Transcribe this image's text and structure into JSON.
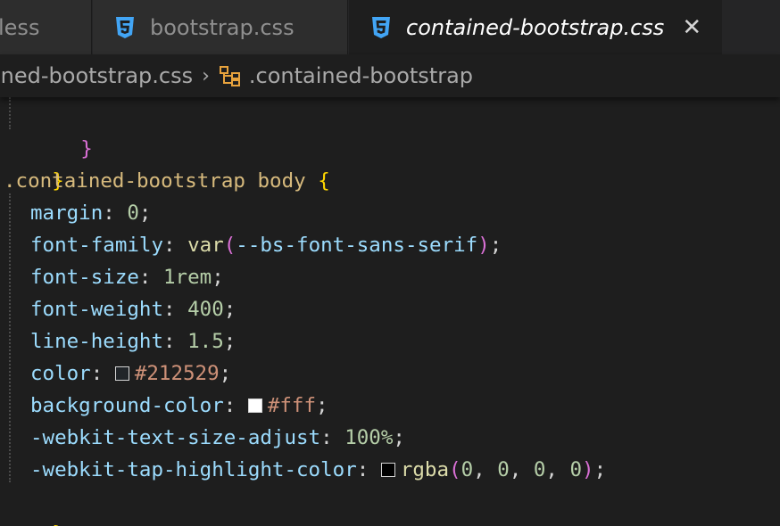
{
  "tabs": [
    {
      "label": "less",
      "icon": "css-file-icon"
    },
    {
      "label": "bootstrap.css",
      "icon": "css-file-icon"
    },
    {
      "label": "contained-bootstrap.css",
      "icon": "css-file-icon",
      "active": true
    }
  ],
  "close_glyph": "✕",
  "breadcrumb": {
    "file": "ined-bootstrap.css",
    "separator": "›",
    "symbol": ".contained-bootstrap"
  },
  "code": {
    "l0_brace": "}",
    "l1_brace": "}",
    "l2_selector": ".contained-bootstrap",
    "l2_tag": "body",
    "l2_brace": "{",
    "decls": [
      {
        "prop": "margin",
        "value": "0"
      },
      {
        "prop": "font-family",
        "fn": "var",
        "arg": "--bs-font-sans-serif"
      },
      {
        "prop": "font-size",
        "value": "1rem"
      },
      {
        "prop": "font-weight",
        "value": "400"
      },
      {
        "prop": "line-height",
        "value": "1.5"
      },
      {
        "prop": "color",
        "value": "#212529",
        "swatch": "#212529"
      },
      {
        "prop": "background-color",
        "value": "#fff",
        "swatch": "#ffffff"
      },
      {
        "prop": "-webkit-text-size-adjust",
        "value": "100%"
      },
      {
        "prop": "-webkit-tap-highlight-color",
        "fn": "rgba",
        "args": [
          "0",
          "0",
          "0",
          "0"
        ],
        "swatch": "#000000"
      }
    ],
    "close_brace": "}"
  },
  "colors": {
    "editor_bg": "#1e1e1e",
    "css_icon": "#42a5f5",
    "selector": "#d7ba7d",
    "property": "#9cdcfe",
    "number": "#b5cea8",
    "string": "#ce9178",
    "function": "#dcdcaa",
    "brace_gold": "#ffd700",
    "brace_pink": "#da70d6"
  }
}
